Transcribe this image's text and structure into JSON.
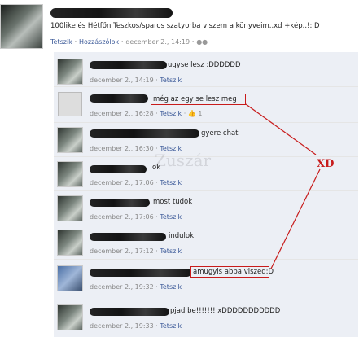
{
  "post": {
    "text": "100like és Hétfőn Teszkos/sparos szatyorba viszem a könyveim..xd +kép..!: D",
    "meta": {
      "like": "Tetszik",
      "comments": "Hozzászólok",
      "date": "december 2., 14:19",
      "sep": "·"
    }
  },
  "comments": [
    {
      "text": "ugyse lesz :DDDDDD",
      "date": "december 2., 14:19",
      "like": "Tetszik"
    },
    {
      "text": "még az egy se lesz meg",
      "date": "december 2., 16:28",
      "like": "Tetszik",
      "likes": "1"
    },
    {
      "text": "gyere chat",
      "date": "december 2., 16:30",
      "like": "Tetszik"
    },
    {
      "text": "ok",
      "date": "december 2., 17:06",
      "like": "Tetszik"
    },
    {
      "text": "most tudok",
      "date": "december 2., 17:06",
      "like": "Tetszik"
    },
    {
      "text": "indulok",
      "date": "december 2., 17:12",
      "like": "Tetszik"
    },
    {
      "text": "amugyis abba viszed:D",
      "date": "december 2., 19:32",
      "like": "Tetszik"
    },
    {
      "text": "pjad be!!!!!!! xDDDDDDDDDDD",
      "date": "december 2., 19:33",
      "like": "Tetszik"
    }
  ],
  "annotation": {
    "label": "XD",
    "color": "#c81b1b"
  },
  "colors": {
    "link": "#3b5998",
    "comment_bg": "#eceff5",
    "annotation": "#c81b1b"
  }
}
